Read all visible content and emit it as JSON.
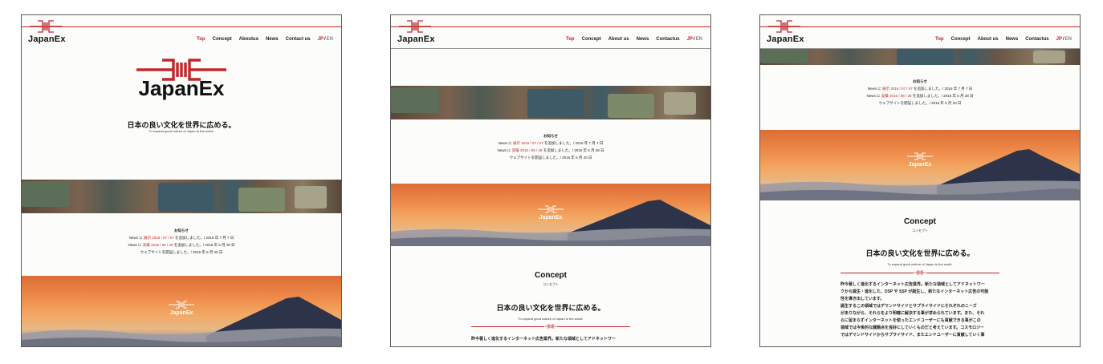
{
  "site": {
    "brand": "JapanEx",
    "nav": [
      "Top",
      "Concept",
      "About us",
      "News",
      "Contact us"
    ],
    "nav_frame1_about": "Aboutus",
    "nav_frame2_contact": "Contactus",
    "lang_jp": "JP",
    "lang_sep": "/",
    "lang_en": "EN"
  },
  "hero": {
    "brand": "JapanEx",
    "tagline_jp": "日本の良い文化を世界に広める。",
    "tagline_en": "To expand good culture of Japan to the world."
  },
  "news": {
    "heading": "お知らせ",
    "items": [
      {
        "prefix": "News に ",
        "link": "展示 2016 / 07 / 07",
        "suffix": " を追加しました。/ 2016 年 7 月 7 日"
      },
      {
        "prefix": "News に ",
        "link": "実績 2016 / 06 / 28",
        "suffix": " を追加しました。/ 2016 年 6 月 28 日"
      },
      {
        "prefix": "",
        "link": "",
        "suffix": "ウェブサイトを開設しました。/ 2016 年 5 月 20 日"
      }
    ]
  },
  "banner": {
    "brand": "JapanEx"
  },
  "concept": {
    "title": "Concept",
    "subtitle": "コンセプト",
    "tagline_jp": "日本の良い文化を世界に広める。",
    "tagline_en": "To expand good culture of Japan to the world.",
    "paragraph_short": "昨今著しく進化するインターネット広告業界。新たな領域としてアドネットワー",
    "paragraph_lines": [
      "昨今著しく進化するインターネット広告業界。新たな領域としてアドネットワー",
      "クから誕生・進化した、DSP や SSP が誕生し、新たなインターネット広告の可能",
      "性を導き出しています。",
      "誕生するこの領域ではデマンドサイドとサプライサイドにそれぞれのニーズ",
      "がありながら、それらをより明確に解決する事が求められています。また、それ",
      "らに留まらずインターネットを使ったエンドユーザーにも貢献できる事がこの",
      "領域では今後的な課題点を良好にしていくものだと考えています。コスモロジー",
      "ではデマンドサイドからサプライサイド、またエンドユーザーに貢献していく事"
    ]
  },
  "colors": {
    "accent": "#c0262c",
    "text": "#111111",
    "background": "#fcfcfa"
  }
}
